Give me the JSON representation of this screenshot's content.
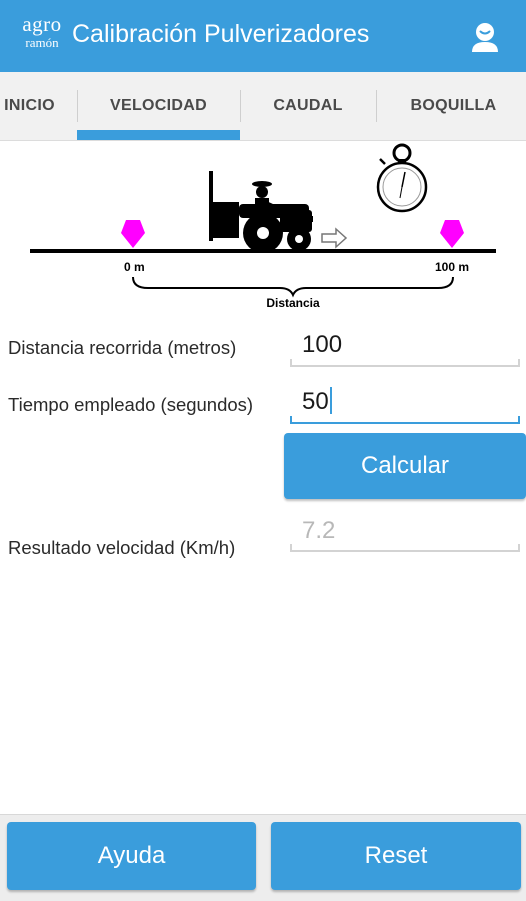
{
  "app": {
    "logo_line1": "agro",
    "logo_line2": "ramón",
    "title": "Calibración Pulverizadores",
    "user_icon": "user-account-icon"
  },
  "tabs": [
    {
      "label": "INICIO",
      "selected": false
    },
    {
      "label": "VELOCIDAD",
      "selected": true
    },
    {
      "label": "CAUDAL",
      "selected": false
    },
    {
      "label": "BOQUILLA",
      "selected": false
    }
  ],
  "illustration": {
    "start_label": "0 m",
    "end_label": "100 m",
    "distance_label": "Distancia"
  },
  "form": {
    "distance_label": "Distancia recorrida (metros)",
    "distance_value": "100",
    "time_label": "Tiempo empleado (segundos)",
    "time_value": "50",
    "calc_label": "Calcular",
    "result_label": "Resultado velocidad (Km/h)",
    "result_value": "7.2"
  },
  "bottom": {
    "help_label": "Ayuda",
    "reset_label": "Reset"
  },
  "colors": {
    "primary": "#3a9ddc",
    "marker": "#ff00ff",
    "tab_background": "#f1f1f1"
  }
}
